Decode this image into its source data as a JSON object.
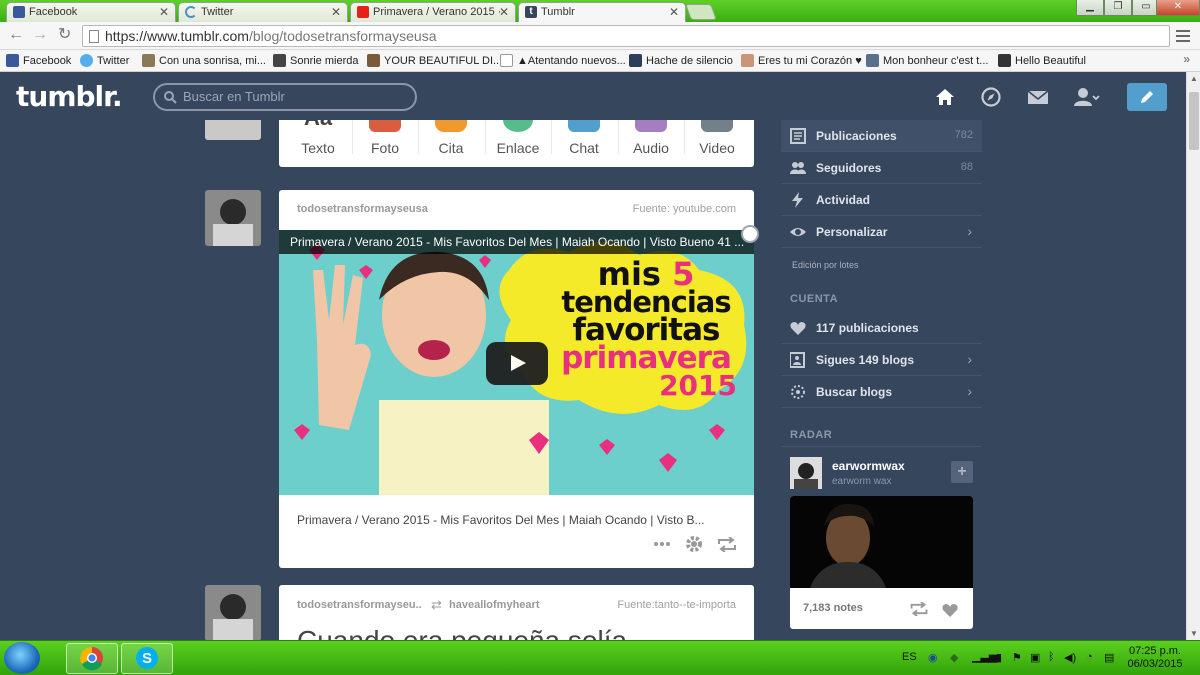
{
  "browser": {
    "tabs": [
      {
        "title": "Facebook",
        "favicon_color": "#3b5998"
      },
      {
        "title": "Twitter",
        "favicon_color": "#55acee"
      },
      {
        "title": "Primavera / Verano 2015 ·",
        "favicon_color": "#e62117"
      },
      {
        "title": "Tumblr",
        "favicon_color": "#36465d"
      }
    ],
    "url_host": "https://www.tumblr.com",
    "url_path": "/blog/todosetransformayseusa",
    "bookmarks": [
      "Facebook",
      "Twitter",
      "Con una sonrisa, mi...",
      "Sonrie mierda",
      "YOUR BEAUTIFUL DI...",
      "▲Atentando nuevos...",
      "Hache de silencio",
      "Eres tu mi Corazón ♥",
      "Mon bonheur c'est t...",
      "Hello Beautiful"
    ]
  },
  "header": {
    "logo": "tumblr.",
    "search_placeholder": "Buscar en Tumblr",
    "accent": "#529ecc",
    "icons": [
      "home-icon",
      "explore-icon",
      "mail-icon",
      "account-icon",
      "compose-icon"
    ]
  },
  "composer": {
    "items": [
      {
        "label": "Texto",
        "color": "#444444"
      },
      {
        "label": "Foto",
        "color": "#d95e40"
      },
      {
        "label": "Cita",
        "color": "#f2992e"
      },
      {
        "label": "Enlace",
        "color": "#56bc8a"
      },
      {
        "label": "Chat",
        "color": "#529ecc"
      },
      {
        "label": "Audio",
        "color": "#a77dc2"
      },
      {
        "label": "Video",
        "color": "#748089"
      }
    ]
  },
  "post1": {
    "blog": "todosetransformayseusa",
    "source": "Fuente: youtube.com",
    "video_title": "Primavera / Verano 2015 - Mis Favoritos Del Mes | Maiah Ocando | Visto Bueno 41 ...",
    "overlay": {
      "line1": "mis",
      "num": "5",
      "line2": "tendencias",
      "line3": "favoritas",
      "line4": "primavera",
      "line5": "2015"
    },
    "caption": "Primavera / Verano 2015 - Mis Favoritos Del Mes | Maiah Ocando | Visto B..."
  },
  "post2": {
    "blog": "todosetransformayseu..",
    "reblog_from": "haveallofmyheart",
    "source": "Fuente:tanto--te-importa",
    "text": "Cuando era pequeña solía"
  },
  "sidebar": {
    "rows": [
      {
        "label": "Publicaciones",
        "count": "782"
      },
      {
        "label": "Seguidores",
        "count": "88"
      },
      {
        "label": "Actividad"
      },
      {
        "label": "Personalizar"
      }
    ],
    "bulk_edit": "Edición por lotes",
    "account_head": "CUENTA",
    "account_rows": [
      {
        "label": "117 publicaciones"
      },
      {
        "label": "Sigues 149 blogs"
      },
      {
        "label": "Buscar blogs"
      }
    ],
    "radar_head": "RADAR",
    "radar_blog": "earwormwax",
    "radar_sub": "earworm wax",
    "radar_notes": "7,183 notes"
  },
  "taskbar": {
    "lang": "ES",
    "time": "07:25 p.m.",
    "date": "06/03/2015"
  }
}
